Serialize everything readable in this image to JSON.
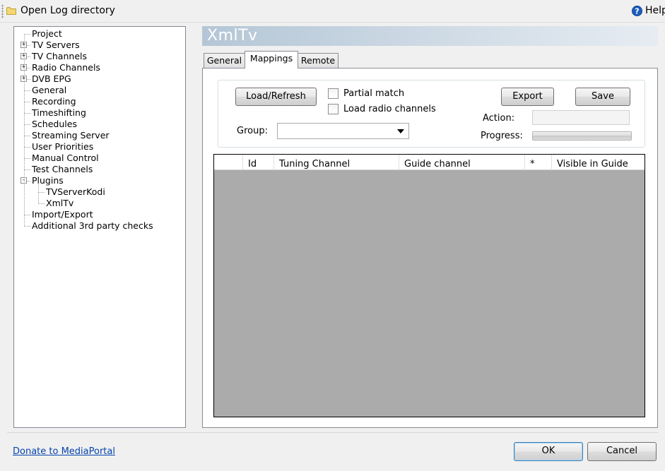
{
  "toolbar": {
    "open_log": "Open Log directory",
    "help": "Help"
  },
  "tree": {
    "items": [
      {
        "label": "Project",
        "level": 0,
        "expander": ""
      },
      {
        "label": "TV Servers",
        "level": 0,
        "expander": "+"
      },
      {
        "label": "TV Channels",
        "level": 0,
        "expander": "+"
      },
      {
        "label": "Radio Channels",
        "level": 0,
        "expander": "+"
      },
      {
        "label": "DVB EPG",
        "level": 0,
        "expander": "+"
      },
      {
        "label": "General",
        "level": 0,
        "expander": ""
      },
      {
        "label": "Recording",
        "level": 0,
        "expander": ""
      },
      {
        "label": "Timeshifting",
        "level": 0,
        "expander": ""
      },
      {
        "label": "Schedules",
        "level": 0,
        "expander": ""
      },
      {
        "label": "Streaming Server",
        "level": 0,
        "expander": ""
      },
      {
        "label": "User Priorities",
        "level": 0,
        "expander": ""
      },
      {
        "label": "Manual Control",
        "level": 0,
        "expander": ""
      },
      {
        "label": "Test Channels",
        "level": 0,
        "expander": ""
      },
      {
        "label": "Plugins",
        "level": 0,
        "expander": "-"
      },
      {
        "label": "TVServerKodi",
        "level": 1,
        "expander": ""
      },
      {
        "label": "XmlTv",
        "level": 1,
        "expander": ""
      },
      {
        "label": "Import/Export",
        "level": 0,
        "expander": ""
      },
      {
        "label": "Additional 3rd party checks",
        "level": 0,
        "expander": ""
      }
    ]
  },
  "plugin": {
    "title": "XmlTv"
  },
  "tabs": [
    {
      "label": "General",
      "active": false
    },
    {
      "label": "Mappings",
      "active": true
    },
    {
      "label": "Remote",
      "active": false
    }
  ],
  "mappings": {
    "load_refresh": "Load/Refresh",
    "partial_match": "Partial match",
    "load_radio": "Load radio channels",
    "export": "Export",
    "save": "Save",
    "group_label": "Group:",
    "group_value": "",
    "action_label": "Action:",
    "action_value": "",
    "progress_label": "Progress:",
    "progress": 0
  },
  "grid": {
    "columns": [
      "",
      "Id",
      "Tuning Channel",
      "Guide channel",
      "*",
      "Visible in Guide"
    ],
    "rows": []
  },
  "footer": {
    "donate": "Donate to MediaPortal",
    "ok": "OK",
    "cancel": "Cancel"
  },
  "icons": {
    "folder": "folder-icon",
    "help": "help-icon",
    "dropdown": "chevron-down-icon"
  },
  "colors": {
    "accent": "#3c7fb1",
    "link": "#0645ad",
    "grid_background": "#ababab"
  }
}
